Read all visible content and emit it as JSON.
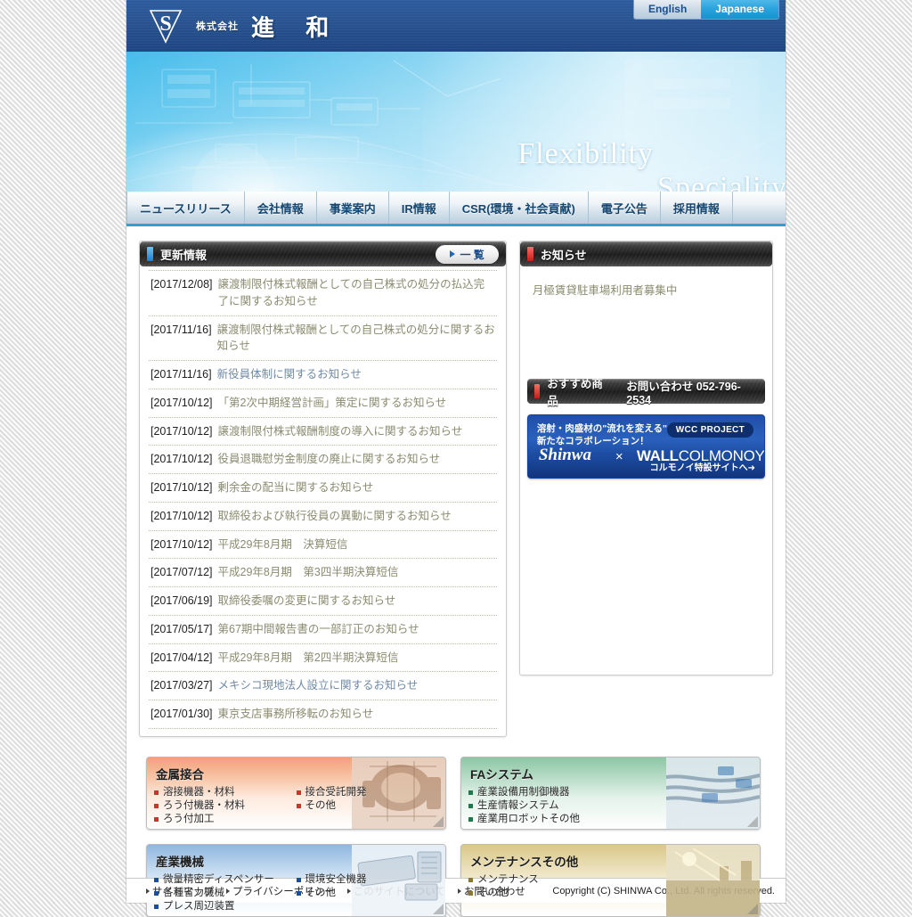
{
  "header": {
    "company_prefix": "株式会社",
    "company_name": "進  和",
    "logo_letter": "S",
    "lang": {
      "english": "English",
      "japanese": "Japanese"
    }
  },
  "hero": {
    "word1": "Flexibility",
    "word2": "Speciality"
  },
  "nav": {
    "items": [
      {
        "label": "ニュースリリース"
      },
      {
        "label": "会社情報"
      },
      {
        "label": "事業案内"
      },
      {
        "label": "IR情報"
      },
      {
        "label": "CSR(環境・社会貢献)"
      },
      {
        "label": "電子公告"
      },
      {
        "label": "採用情報"
      }
    ]
  },
  "news": {
    "title": "更新情報",
    "list_label": "一 覧",
    "items": [
      {
        "date": "[2017/12/08]",
        "title": "譲渡制限付株式報酬としての自己株式の処分の払込完了に関するお知らせ"
      },
      {
        "date": "[2017/11/16]",
        "title": "譲渡制限付株式報酬としての自己株式の処分に関するお知らせ"
      },
      {
        "date": "[2017/11/16]",
        "title": "新役員体制に関するお知らせ"
      },
      {
        "date": "[2017/10/12]",
        "title": "「第2次中期経営計画」策定に関するお知らせ"
      },
      {
        "date": "[2017/10/12]",
        "title": "譲渡制限付株式報酬制度の導入に関するお知らせ"
      },
      {
        "date": "[2017/10/12]",
        "title": "役員退職慰労金制度の廃止に関するお知らせ"
      },
      {
        "date": "[2017/10/12]",
        "title": "剰余金の配当に関するお知らせ"
      },
      {
        "date": "[2017/10/12]",
        "title": "取締役および執行役員の異動に関するお知らせ"
      },
      {
        "date": "[2017/10/12]",
        "title": "平成29年8月期　決算短信"
      },
      {
        "date": "[2017/07/12]",
        "title": "平成29年8月期　第3四半期決算短信"
      },
      {
        "date": "[2017/06/19]",
        "title": "取締役委嘱の変更に関するお知らせ"
      },
      {
        "date": "[2017/05/17]",
        "title": "第67期中間報告書の一部訂正のお知らせ"
      },
      {
        "date": "[2017/04/12]",
        "title": "平成29年8月期　第2四半期決算短信"
      },
      {
        "date": "[2017/03/27]",
        "title": "メキシコ現地法人設立に関するお知らせ"
      },
      {
        "date": "[2017/01/30]",
        "title": "東京支店事務所移転のお知らせ"
      }
    ]
  },
  "notice": {
    "title": "お知らせ",
    "text": "月極賃貸駐車場利用者募集中",
    "cta_title": "おすすめ商品",
    "cta_phone": "お問い合わせ 052-796-2534"
  },
  "banner": {
    "line1": "溶射・肉盛材の\"流れを変える\"",
    "line2": "新たなコラボレーション！",
    "project_tag": "WCC PROJECT",
    "brand_left": "Shinwa",
    "times": "×",
    "brand_right_bold": "WALL",
    "brand_right_light": "COLMONOY",
    "link_text": "コルモノイ特設サイトへ➜"
  },
  "cards": [
    {
      "title": "金属接合",
      "col1": [
        "溶接機器・材料",
        "ろう付機器・材料",
        "ろう付加工"
      ],
      "col2": [
        "接合受託開発",
        "その他"
      ]
    },
    {
      "title": "FAシステム",
      "col1": [
        "産業設備用制御機器",
        "生産情報システム",
        "産業用ロボットその他"
      ],
      "col2": []
    },
    {
      "title": "産業機械",
      "col1": [
        "微量精密ディスペンサー",
        "各種省力機械",
        "プレス周辺装置"
      ],
      "col2": [
        "環境安全機器",
        "その他"
      ]
    },
    {
      "title": "メンテナンスその他",
      "col1": [
        "メンテナンス",
        "その他"
      ],
      "col2": []
    }
  ],
  "footer": {
    "links": [
      {
        "label": "サイトマップ"
      },
      {
        "label": "プライバシーポリシー"
      },
      {
        "label": "このサイトについて"
      },
      {
        "label": "お問い合わせ"
      }
    ],
    "copyright": "Copyright (C) SHINWA Co., Ltd. All rights reserved."
  },
  "colors": {
    "header_blue": "#28538f",
    "nav_accent": "#2f9fd4",
    "lang_active": "#29a2dd",
    "banner_blue": "#1f4fa8"
  }
}
